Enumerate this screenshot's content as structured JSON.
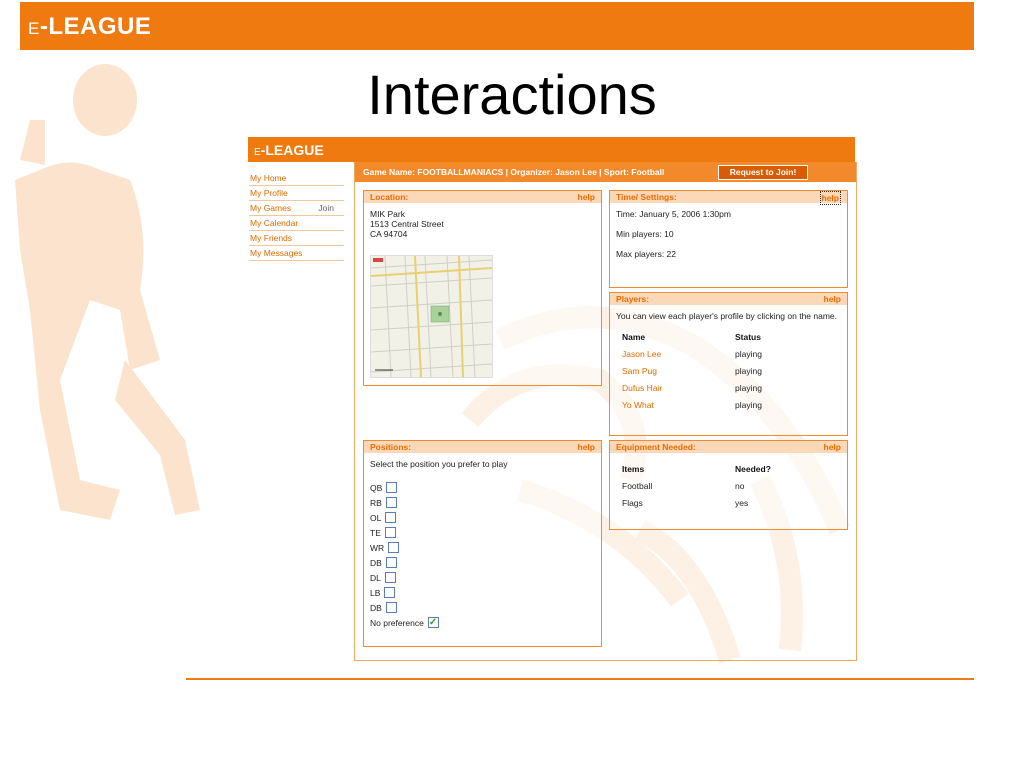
{
  "slide": {
    "logo_prefix": "E",
    "logo_text": "-LEAGUE",
    "title": "Interactions"
  },
  "app": {
    "logo_prefix": "E",
    "logo_text": "-LEAGUE",
    "nav": [
      {
        "label": "My Home"
      },
      {
        "label": "My Profile"
      },
      {
        "label": "My Games",
        "extra": "Join"
      },
      {
        "label": "My Calendar"
      },
      {
        "label": "My Friends"
      },
      {
        "label": "My Messages"
      }
    ],
    "info_bar": {
      "text": "Game Name: FOOTBALLMANIACS   |   Organizer: Jason Lee   |   Sport: Football",
      "join_button": "Request to Join!"
    },
    "location": {
      "title": "Location:",
      "help": "help",
      "line1": "MIK Park",
      "line2": "1513 Central Street",
      "line3": "CA 94704"
    },
    "time": {
      "title": "Time/ Settings:",
      "help": "help",
      "time": "Time: January 5, 2006 1:30pm",
      "min": "Min players: 10",
      "max": "Max players: 22"
    },
    "players": {
      "title": "Players:",
      "help": "help",
      "intro": "You can view each player's profile by clicking on the name.",
      "col_name": "Name",
      "col_status": "Status",
      "rows": [
        {
          "name": "Jason Lee",
          "status": "playing"
        },
        {
          "name": "Sam Pug",
          "status": "playing"
        },
        {
          "name": "Dufus Hair",
          "status": "playing"
        },
        {
          "name": "Yo What",
          "status": "playing"
        }
      ]
    },
    "positions": {
      "title": "Positions:",
      "help": "help",
      "intro": "Select the position you prefer to play",
      "items": [
        {
          "label": "QB",
          "checked": false
        },
        {
          "label": "RB",
          "checked": false
        },
        {
          "label": "OL",
          "checked": false
        },
        {
          "label": "TE",
          "checked": false
        },
        {
          "label": "WR",
          "checked": false
        },
        {
          "label": "DB",
          "checked": false
        },
        {
          "label": "DL",
          "checked": false
        },
        {
          "label": "LB",
          "checked": false
        },
        {
          "label": "DB",
          "checked": false
        },
        {
          "label": "No preference",
          "checked": true
        }
      ]
    },
    "equipment": {
      "title": "Equipment Needed:",
      "help": "help",
      "col_items": "Items",
      "col_needed": "Needed?",
      "rows": [
        {
          "item": "Football",
          "needed": "no"
        },
        {
          "item": "Flags",
          "needed": "yes"
        }
      ]
    }
  },
  "colors": {
    "brand_orange": "#ef7a10",
    "panel_head_bg": "#fbd9b8",
    "link_orange": "#e06a00"
  }
}
